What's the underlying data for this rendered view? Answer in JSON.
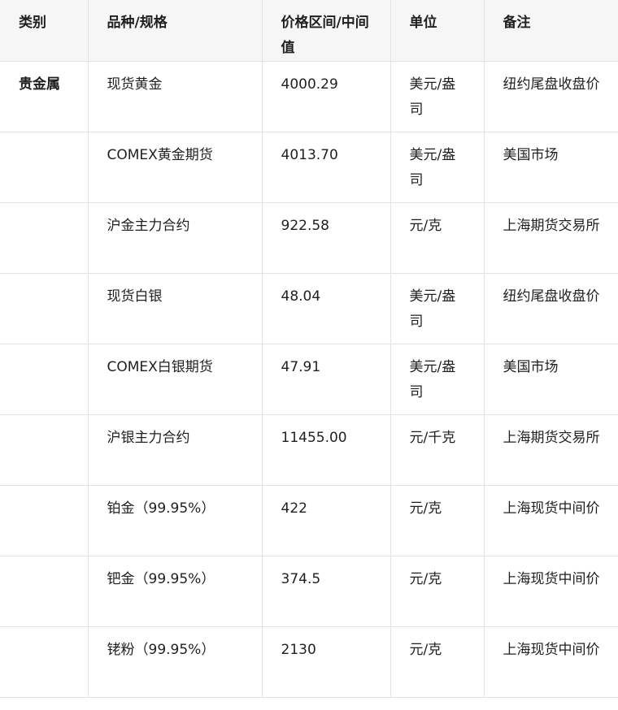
{
  "table": {
    "headers": [
      "类别",
      "品种/规格",
      "价格区间/中间值",
      "单位",
      "备注"
    ],
    "rows": [
      {
        "category": "贵金属",
        "item": "现货黄金",
        "price": "4000.29",
        "unit": "美元/盎司",
        "note": "纽约尾盘收盘价"
      },
      {
        "category": "",
        "item": "COMEX黄金期货",
        "price": "4013.70",
        "unit": "美元/盎司",
        "note": "美国市场"
      },
      {
        "category": "",
        "item": "沪金主力合约",
        "price": "922.58",
        "unit": "元/克",
        "note": "上海期货交易所"
      },
      {
        "category": "",
        "item": "现货白银",
        "price": "48.04",
        "unit": "美元/盎司",
        "note": "纽约尾盘收盘价"
      },
      {
        "category": "",
        "item": "COMEX白银期货",
        "price": "47.91",
        "unit": "美元/盎司",
        "note": "美国市场"
      },
      {
        "category": "",
        "item": "沪银主力合约",
        "price": "11455.00",
        "unit": "元/千克",
        "note": "上海期货交易所"
      },
      {
        "category": "",
        "item": "铂金（99.95%）",
        "price": "422",
        "unit": "元/克",
        "note": "上海现货中间价"
      },
      {
        "category": "",
        "item": "钯金（99.95%）",
        "price": "374.5",
        "unit": "元/克",
        "note": "上海现货中间价"
      },
      {
        "category": "",
        "item": "铑粉（99.95%）",
        "price": "2130",
        "unit": "元/克",
        "note": "上海现货中间价"
      }
    ]
  }
}
